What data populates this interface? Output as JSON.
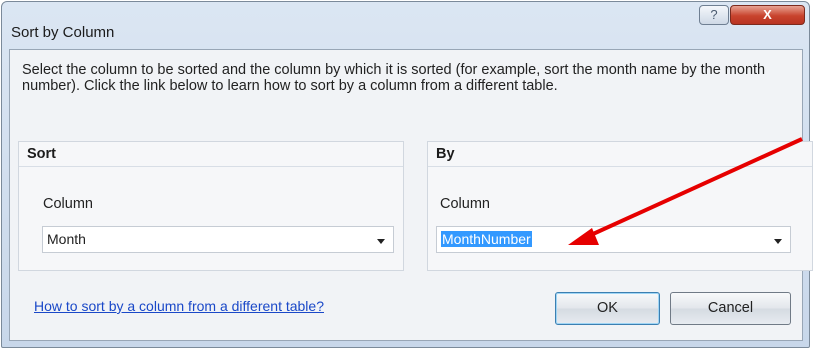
{
  "dialog": {
    "title": "Sort by Column",
    "help_glyph": "?",
    "close_glyph": "X",
    "description": "Select the column to be sorted and the column by which it is sorted (for example, sort the month name by the month number). Click the link below to learn how to sort by a column from a different table."
  },
  "sort": {
    "header": "Sort",
    "column_label": "Column",
    "column_value": "Month"
  },
  "by": {
    "header": "By",
    "column_label": "Column",
    "column_value": "MonthNumber"
  },
  "link_text": "How to sort by a column from a different table?",
  "buttons": {
    "ok": "OK",
    "cancel": "Cancel"
  },
  "colors": {
    "annotation_arrow": "#e60000",
    "selection": "#3399ff",
    "link": "#1a48c8"
  }
}
